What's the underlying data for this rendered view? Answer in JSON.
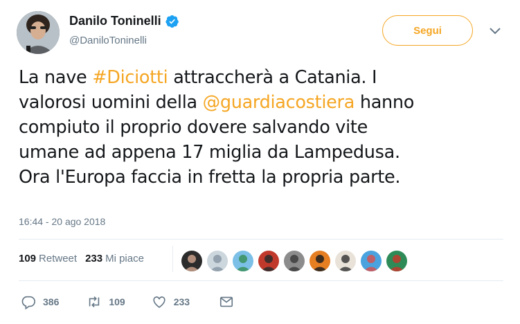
{
  "header": {
    "display_name": "Danilo Toninelli",
    "handle": "@DaniloToninelli",
    "follow_label": "Segui"
  },
  "tweet": {
    "segments": [
      {
        "text": "La nave ",
        "link": false
      },
      {
        "text": "#Diciotti",
        "link": true
      },
      {
        "text": " attraccherà a Catania. I\nvalorosi uomini della ",
        "link": false
      },
      {
        "text": "@guardiacostiera",
        "link": true
      },
      {
        "text": " hanno\ncompiuto il proprio dovere salvando vite\numane ad appena 17 miglia da Lampedusa.\nOra l'Europa faccia in fretta la propria parte.",
        "link": false
      }
    ],
    "timestamp": "16:44 - 20 ago 2018"
  },
  "stats": {
    "retweets": "109",
    "retweets_label": "Retweet",
    "likes": "233",
    "likes_label": "Mi piace"
  },
  "likers": [
    {
      "icon": "avatar-woman-dark-hair",
      "colors": [
        "#2b2b2b",
        "#c9a08a"
      ]
    },
    {
      "icon": "avatar-default-silhouette",
      "colors": [
        "#ccd6dd",
        "#8899a6"
      ]
    },
    {
      "icon": "avatar-landscape",
      "colors": [
        "#7cc0e8",
        "#3a8f5c"
      ]
    },
    {
      "icon": "avatar-man-red",
      "colors": [
        "#c0392b",
        "#2c2c2c"
      ]
    },
    {
      "icon": "avatar-man-grey",
      "colors": [
        "#8c8c8c",
        "#3d3d3d"
      ]
    },
    {
      "icon": "avatar-orange-logo",
      "colors": [
        "#e67e22",
        "#1e1e1e"
      ]
    },
    {
      "icon": "avatar-woman-light",
      "colors": [
        "#e8e2d8",
        "#3b3b3b"
      ]
    },
    {
      "icon": "avatar-people-colorful",
      "colors": [
        "#4aa3df",
        "#d35454"
      ]
    },
    {
      "icon": "avatar-flag-tricolore",
      "colors": [
        "#2e8b57",
        "#c0392b"
      ]
    }
  ],
  "actions": {
    "replies": "386",
    "retweets": "109",
    "likes": "233"
  },
  "colors": {
    "accent": "#f5a623",
    "muted": "#657786",
    "verified": "#1da1f2",
    "text": "#14171a",
    "divider": "#e6ecf0"
  }
}
